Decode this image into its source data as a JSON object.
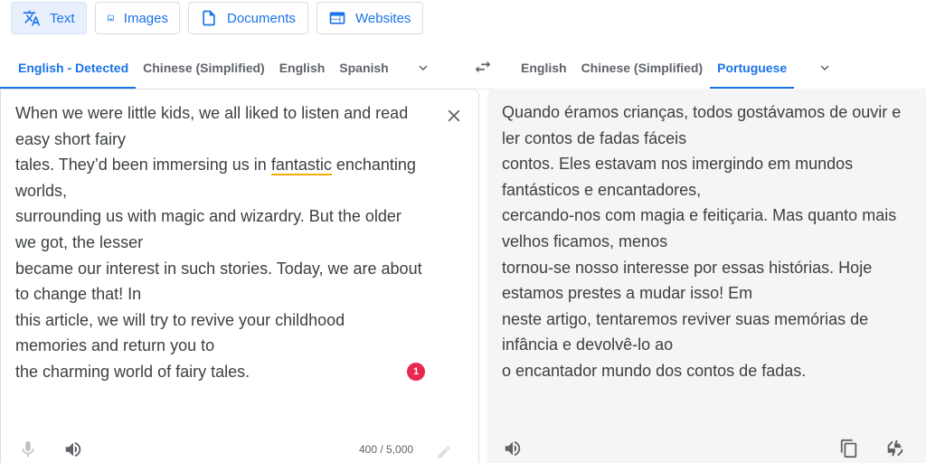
{
  "modes": {
    "text": "Text",
    "images": "Images",
    "documents": "Documents",
    "websites": "Websites"
  },
  "source_langs": [
    "English - Detected",
    "Chinese (Simplified)",
    "English",
    "Spanish"
  ],
  "target_langs": [
    "English",
    "Chinese (Simplified)",
    "Portuguese"
  ],
  "source": {
    "line1": "When we were little kids, we all liked to listen and read\neasy short fairy\ntales. They’d been immersing us in ",
    "underlined": "fantastic",
    "line2": " enchanting\nworlds,\nsurrounding us with magic and wizardry. But the older\nwe got, the lesser\nbecame our interest in such stories. Today, we are about\nto change that! In\nthis article, we will try to revive your childhood\nmemories and return you to\nthe charming world of fairy tales.",
    "badge_count": "1",
    "char_count": "400 / 5,000"
  },
  "target": {
    "text": "Quando éramos crianças, todos gostávamos de ouvir e\nler contos de fadas fáceis\ncontos. Eles estavam nos imergindo em mundos\nfantásticos e encantadores,\ncercando-nos com magia e feitiçaria. Mas quanto mais\nvelhos ficamos, menos\ntornou-se nosso interesse por essas histórias. Hoje\nestamos prestes a mudar isso! Em\nneste artigo, tentaremos reviver suas memórias de\ninfância e devolvê-lo ao\no encantador mundo dos contos de fadas."
  },
  "icons": {
    "text_mode": "translate-icon",
    "images_mode": "image-icon",
    "documents_mode": "document-icon",
    "websites_mode": "web-icon",
    "swap": "swap-icon",
    "clear": "close-icon",
    "mic": "mic-icon",
    "speaker": "speaker-icon",
    "pencil": "pencil-icon",
    "copy": "copy-icon",
    "feedback": "rate-icon"
  },
  "colors": {
    "accent": "#1a73e8",
    "badge": "#e8284f",
    "underline": "#f9ab00",
    "target_bg": "#f5f5f5"
  }
}
